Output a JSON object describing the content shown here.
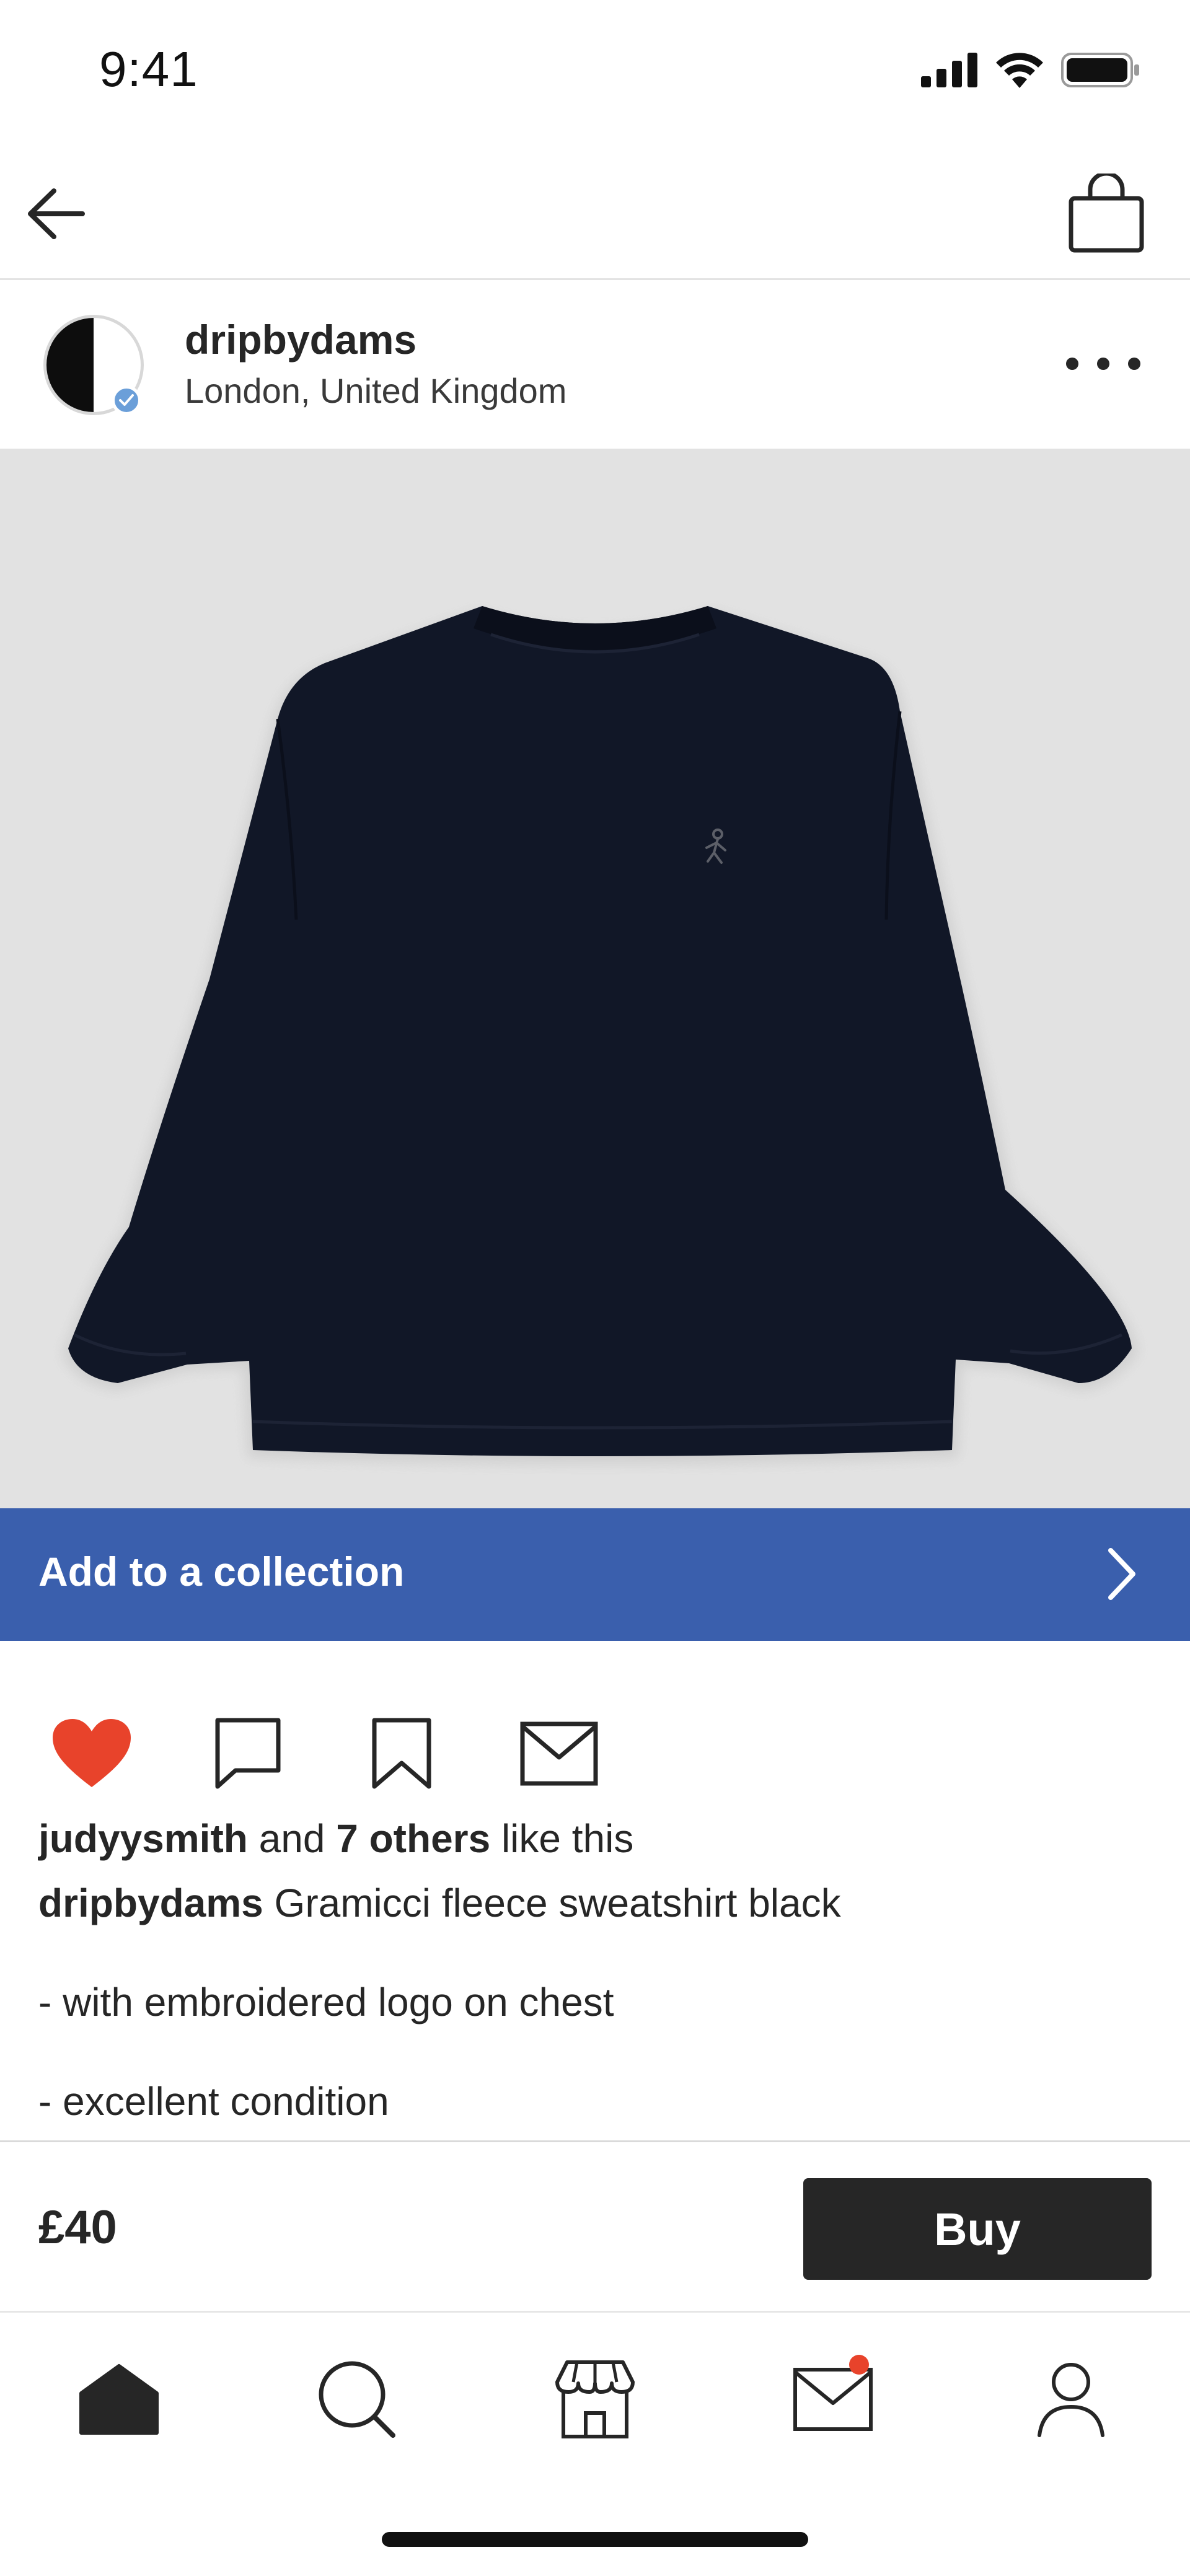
{
  "status_bar": {
    "time": "9:41"
  },
  "nav": {
    "back_icon": "arrow-left-icon",
    "bag_icon": "shopping-bag-icon"
  },
  "seller": {
    "username": "dripbydams",
    "location": "London, United Kingdom",
    "verified": true
  },
  "collection_banner": {
    "label": "Add to a collection",
    "color": "#3a5fad"
  },
  "actions": {
    "liked": true,
    "like_color": "#e8432b"
  },
  "likes": {
    "user": "judyysmith",
    "connector": "and",
    "others": "7 others",
    "suffix": "like this"
  },
  "caption": {
    "username": "dripbydams",
    "title": "Gramicci fleece sweatshirt black"
  },
  "description": [
    "- with embroidered logo on chest",
    "- excellent condition"
  ],
  "purchase": {
    "price": "£40",
    "buy_label": "Buy"
  },
  "tab_bar": {
    "items": [
      "home",
      "search",
      "shop",
      "messages",
      "profile"
    ],
    "active": "home",
    "messages_has_notification": true,
    "notification_color": "#e8432b"
  }
}
